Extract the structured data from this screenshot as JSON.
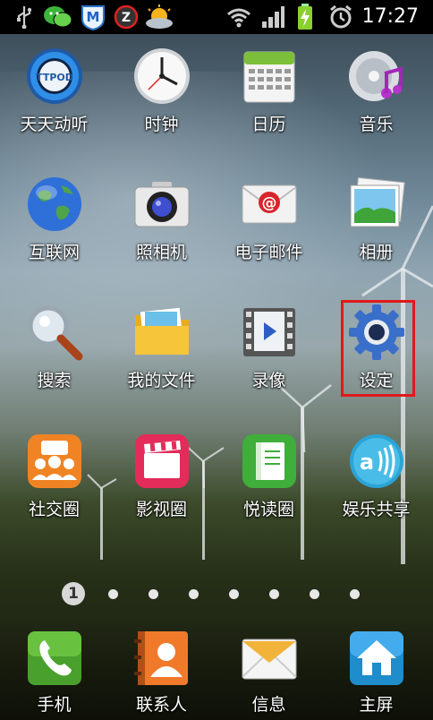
{
  "status_bar": {
    "time": "17:27",
    "icons": [
      "usb-icon",
      "wechat-icon",
      "maxthon-icon",
      "z-app-icon",
      "weather-icon",
      "wifi-icon",
      "signal-icon",
      "battery-charging-icon",
      "alarm-icon"
    ]
  },
  "apps": [
    {
      "label": "天天动听",
      "icon": "ttpod-icon"
    },
    {
      "label": "时钟",
      "icon": "clock-icon"
    },
    {
      "label": "日历",
      "icon": "calendar-icon"
    },
    {
      "label": "音乐",
      "icon": "music-icon"
    },
    {
      "label": "互联网",
      "icon": "globe-icon"
    },
    {
      "label": "照相机",
      "icon": "camera-icon"
    },
    {
      "label": "电子邮件",
      "icon": "email-icon"
    },
    {
      "label": "相册",
      "icon": "gallery-icon"
    },
    {
      "label": "搜索",
      "icon": "search-icon"
    },
    {
      "label": "我的文件",
      "icon": "folder-icon"
    },
    {
      "label": "录像",
      "icon": "video-icon"
    },
    {
      "label": "设定",
      "icon": "settings-gear-icon"
    },
    {
      "label": "社交圈",
      "icon": "social-icon"
    },
    {
      "label": "影视圈",
      "icon": "film-icon"
    },
    {
      "label": "悦读圈",
      "icon": "book-icon"
    },
    {
      "label": "娱乐共享",
      "icon": "share-icon"
    }
  ],
  "pager": {
    "current": "1",
    "total_dots": 8
  },
  "dock": [
    {
      "label": "手机",
      "icon": "phone-icon"
    },
    {
      "label": "联系人",
      "icon": "contacts-icon"
    },
    {
      "label": "信息",
      "icon": "message-icon"
    },
    {
      "label": "主屏",
      "icon": "home-icon"
    }
  ],
  "colors": {
    "highlight": "#e0191b",
    "label_text": "#ffffff",
    "status_bar_bg": "#000000"
  }
}
